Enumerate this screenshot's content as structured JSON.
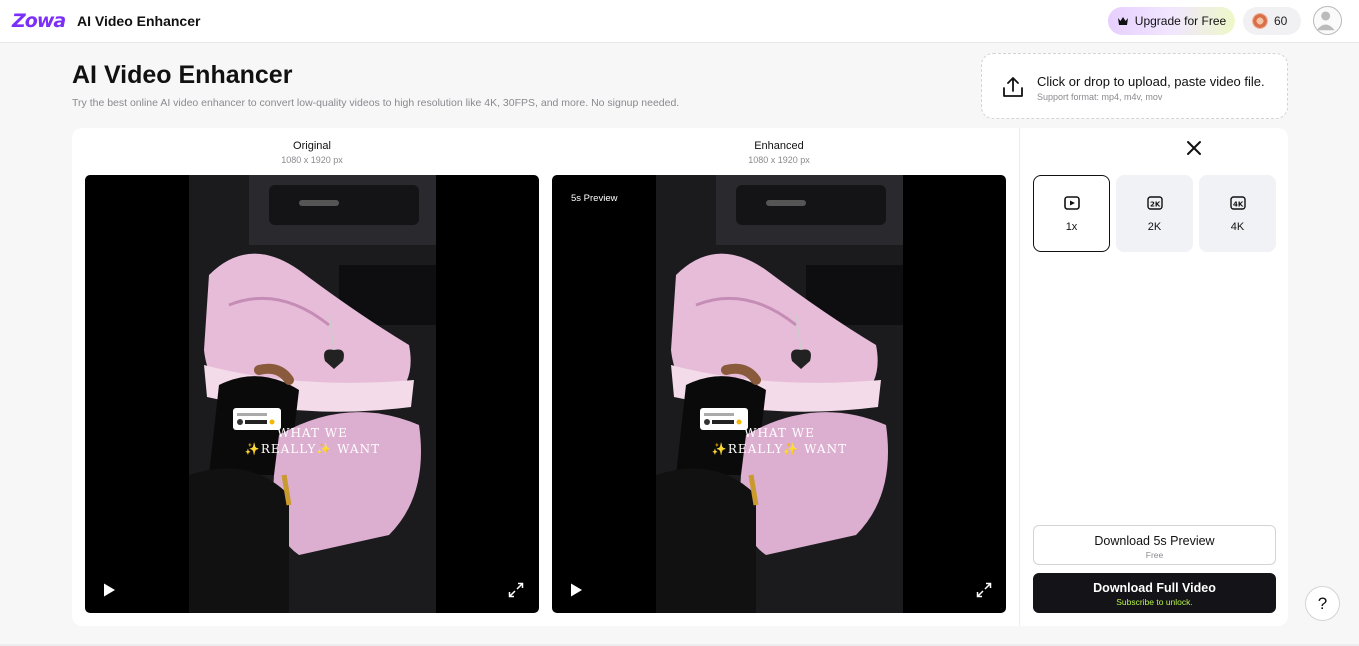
{
  "header": {
    "logo_text": "Zowa",
    "app_title": "AI Video Enhancer",
    "upgrade_label": "Upgrade for Free",
    "credits": "60"
  },
  "page": {
    "title": "AI Video Enhancer",
    "subtitle": "Try the best online AI video enhancer to convert low-quality videos to high resolution like 4K, 30FPS, and more. No signup needed."
  },
  "upload": {
    "main_text": "Click or drop to upload, paste video file.",
    "support_text": "Support format: mp4, m4v, mov"
  },
  "original": {
    "label": "Original",
    "dimensions": "1080 x 1920 px",
    "caption_line1": "WHAT WE",
    "caption_line2": "✨REALLY✨ WANT"
  },
  "enhanced": {
    "label": "Enhanced",
    "dimensions": "1080 x 1920 px",
    "badge": "5s Preview",
    "caption_line1": "WHAT WE",
    "caption_line2": "✨REALLY✨ WANT"
  },
  "resolutions": [
    {
      "label": "1x",
      "icon": "play-box-icon",
      "selected": true
    },
    {
      "label": "2K",
      "icon": "2k-icon",
      "selected": false
    },
    {
      "label": "4K",
      "icon": "4k-icon",
      "selected": false
    }
  ],
  "actions": {
    "preview_label": "Download 5s Preview",
    "preview_sub": "Free",
    "full_label": "Download Full Video",
    "full_sub": "Subscribe to unlock."
  },
  "help_label": "?",
  "colors": {
    "brand": "#7b2ff7",
    "primary_button": "#141418",
    "unlock_text": "#b6f24a",
    "shoe_pink": "#e7bcd9"
  }
}
